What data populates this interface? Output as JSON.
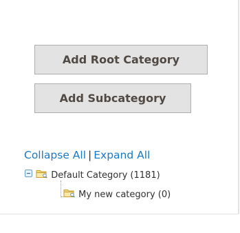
{
  "buttons": {
    "add_root_category": "Add Root Category",
    "add_subcategory": "Add Subcategory"
  },
  "tree_controls": {
    "collapse_all": "Collapse All",
    "separator": "|",
    "expand_all": "Expand All"
  },
  "tree": {
    "root": {
      "label": "Default Category (1181)",
      "icon": "folder-icon",
      "toggle_icon": "collapse-toggle-icon"
    },
    "children": [
      {
        "label": "My new category (0)",
        "icon": "folder-icon"
      }
    ]
  },
  "colors": {
    "link": "#1979c3",
    "button_bg": "#e3e3e3",
    "button_border": "#adadad",
    "button_text": "#514943",
    "tree_text": "#303030"
  }
}
